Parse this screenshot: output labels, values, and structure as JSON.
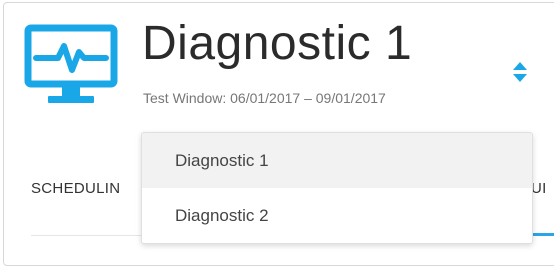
{
  "header": {
    "title": "Diagnostic 1",
    "test_window": "Test Window: 06/01/2017 – 09/01/2017",
    "icon": "monitor-heartbeat-icon",
    "accent_color": "#1aa7e8",
    "sort_icon": "sort-up-down-icon"
  },
  "tabs": [
    {
      "label": "SCHEDULIN"
    },
    {
      "label": "UI"
    }
  ],
  "dropdown": {
    "options": [
      {
        "label": "Diagnostic 1",
        "selected": true
      },
      {
        "label": "Diagnostic 2",
        "selected": false
      }
    ]
  }
}
